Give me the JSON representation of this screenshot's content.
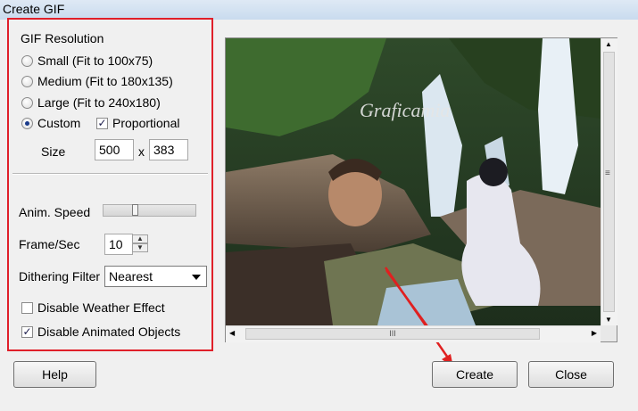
{
  "window": {
    "title": "Create GIF"
  },
  "resolution": {
    "group_label": "GIF Resolution",
    "options": [
      {
        "label": "Small (Fit to 100x75)",
        "selected": false
      },
      {
        "label": "Medium (Fit to 180x135)",
        "selected": false
      },
      {
        "label": "Large (Fit to 240x180)",
        "selected": false
      },
      {
        "label": "Custom",
        "selected": true
      }
    ],
    "proportional_label": "Proportional",
    "proportional_checked": true,
    "size_label": "Size",
    "width": "500",
    "times": "x",
    "height": "383"
  },
  "anim": {
    "speed_label": "Anim. Speed",
    "speed_value": 0.33,
    "fps_label": "Frame/Sec",
    "fps_value": "10",
    "dither_label": "Dithering Filter",
    "dither_value": "Nearest"
  },
  "options": {
    "disable_weather_label": "Disable Weather Effect",
    "disable_weather_checked": false,
    "disable_animated_label": "Disable Animated Objects",
    "disable_animated_checked": true
  },
  "preview": {
    "watermark": "Graficamia",
    "hscroll_grip": "III",
    "vscroll_grip": "≡"
  },
  "buttons": {
    "help": "Help",
    "create": "Create",
    "close": "Close"
  },
  "colors": {
    "highlight_red": "#e0202a",
    "arrow_red": "#e02020"
  }
}
